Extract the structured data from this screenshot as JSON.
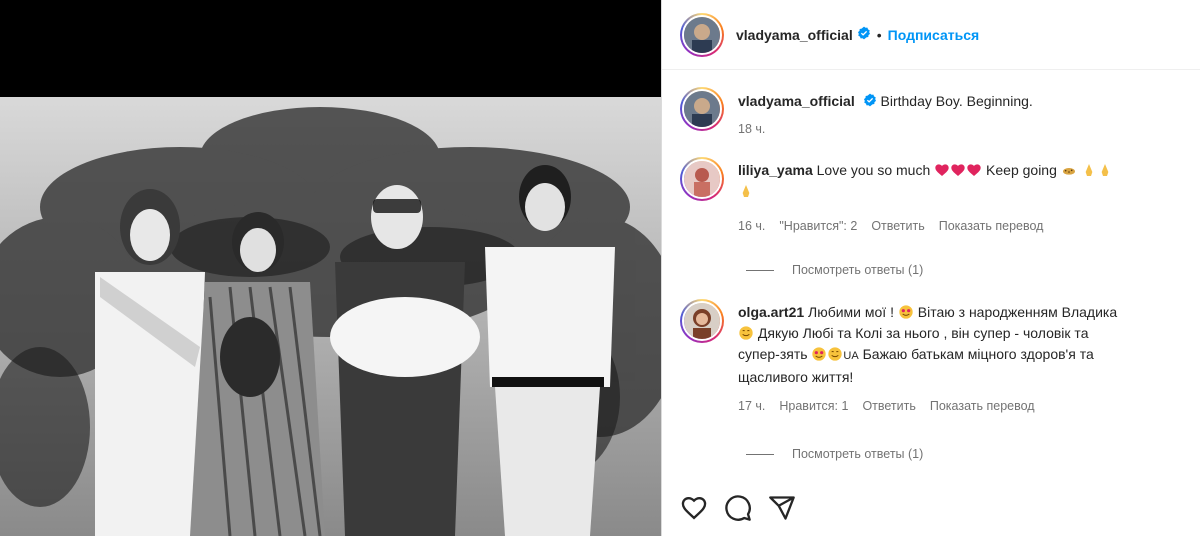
{
  "post": {
    "username": "vladyama_official",
    "follow_label": "Подписаться",
    "dot": "•"
  },
  "caption": {
    "username": "vladyama_official",
    "text": "Birthday Boy. Beginning.",
    "time": "18 ч."
  },
  "comments": [
    {
      "username": "liliya_yama",
      "text_a": "Love you so much",
      "text_b": "Keep going",
      "time": "16 ч.",
      "likes": "\"Нравится\": 2",
      "reply": "Ответить",
      "translate": "Показать перевод",
      "view_replies": "Посмотреть ответы (1)"
    },
    {
      "username": "olga.art21",
      "text_a": "Любими мої !",
      "text_b": "Вітаю з народженням Владика",
      "text_c": "Дякую Любі та Колі за нього , він супер - чоловік та",
      "text_d": "супер-зять",
      "text_e": "UA",
      "text_f": "Бажаю батькам міцного здоров'я та",
      "text_g": "щасливого життя!",
      "time": "17 ч.",
      "likes": "Нравится: 1",
      "reply": "Ответить",
      "translate": "Показать перевод",
      "view_replies": "Посмотреть ответы (1)"
    }
  ],
  "icons": {
    "like": "heart-icon",
    "comment": "comment-icon",
    "share": "share-icon",
    "verified": "verified-badge-icon"
  },
  "colors": {
    "link_blue": "#0095f6",
    "verified_blue": "#0095f6",
    "muted": "#737373",
    "heart_red": "#e0245e"
  }
}
